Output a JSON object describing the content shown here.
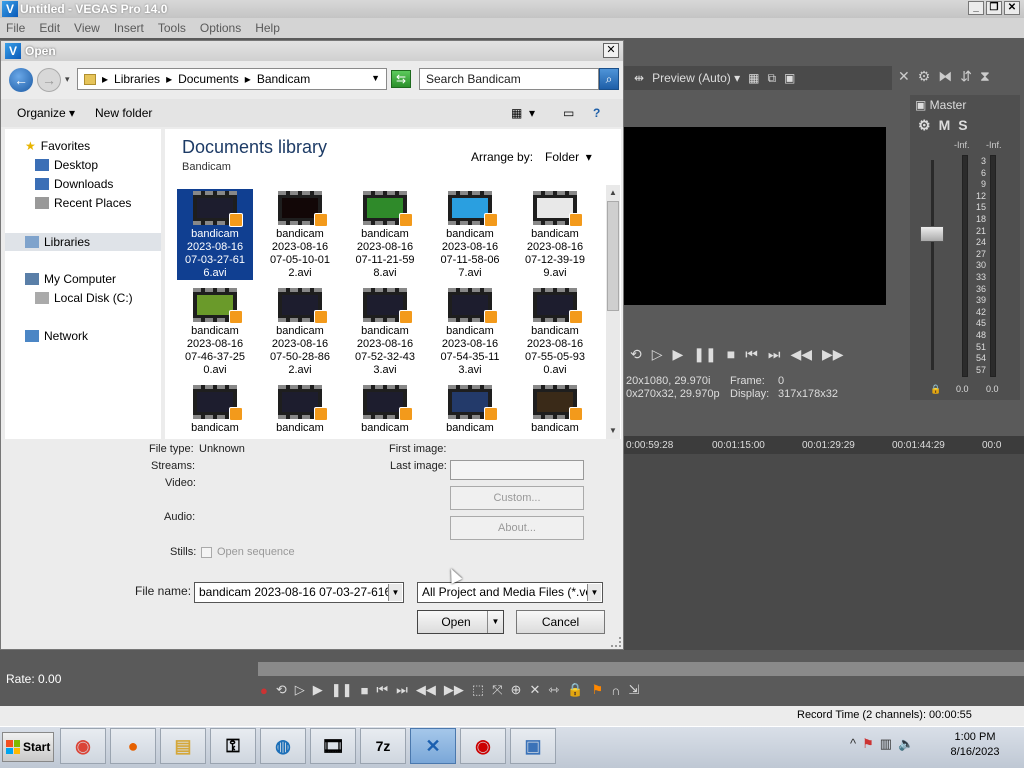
{
  "app": {
    "title": "Untitled - VEGAS Pro 14.0",
    "logo_letter": "V",
    "menu": [
      "File",
      "Edit",
      "View",
      "Insert",
      "Tools",
      "Options",
      "Help"
    ],
    "window_buttons": [
      "_",
      "❐",
      "✕"
    ]
  },
  "preview": {
    "mode_label": "Preview (Auto)",
    "info_left_1": "20x1080, 29.970i",
    "info_left_2": "0x270x32, 29.970p",
    "frame_label": "Frame:",
    "frame_value": "0",
    "display_label": "Display:",
    "display_value": "317x178x32"
  },
  "master": {
    "label": "Master",
    "mute": "M",
    "solo": "S",
    "inf_left": "-Inf.",
    "inf_right": "-Inf.",
    "scale": [
      "3",
      "6",
      "9",
      "12",
      "15",
      "18",
      "21",
      "24",
      "27",
      "30",
      "33",
      "36",
      "39",
      "42",
      "45",
      "48",
      "51",
      "54",
      "57"
    ],
    "bottom_left": "0.0",
    "bottom_right": "0.0"
  },
  "timeline": {
    "ruler": [
      "0:00:59:28",
      "00:01:15:00",
      "00:01:29:29",
      "00:01:44:29",
      "00:0"
    ],
    "rate_label": "Rate: 0.00",
    "record_time": "Record Time (2 channels): 00:00:55"
  },
  "dialog": {
    "title": "Open",
    "close": "✕",
    "breadcrumb": [
      "Libraries",
      "Documents",
      "Bandicam"
    ],
    "search_placeholder": "Search Bandicam",
    "organize": "Organize",
    "new_folder": "New folder",
    "nav": {
      "favorites": "Favorites",
      "desktop": "Desktop",
      "downloads": "Downloads",
      "recent_places": "Recent Places",
      "libraries": "Libraries",
      "my_computer": "My Computer",
      "local_disk": "Local Disk (C:)",
      "network": "Network"
    },
    "library_title": "Documents library",
    "library_sub": "Bandicam",
    "arrange_label": "Arrange by:",
    "arrange_value": "Folder",
    "files": [
      {
        "l1": "bandicam",
        "l2": "2023-08-16",
        "l3": "07-03-27-61",
        "l4": "6.avi"
      },
      {
        "l1": "bandicam",
        "l2": "2023-08-16",
        "l3": "07-05-10-01",
        "l4": "2.avi"
      },
      {
        "l1": "bandicam",
        "l2": "2023-08-16",
        "l3": "07-11-21-59",
        "l4": "8.avi"
      },
      {
        "l1": "bandicam",
        "l2": "2023-08-16",
        "l3": "07-11-58-06",
        "l4": "7.avi"
      },
      {
        "l1": "bandicam",
        "l2": "2023-08-16",
        "l3": "07-12-39-19",
        "l4": "9.avi"
      },
      {
        "l1": "bandicam",
        "l2": "2023-08-16",
        "l3": "07-46-37-25",
        "l4": "0.avi"
      },
      {
        "l1": "bandicam",
        "l2": "2023-08-16",
        "l3": "07-50-28-86",
        "l4": "2.avi"
      },
      {
        "l1": "bandicam",
        "l2": "2023-08-16",
        "l3": "07-52-32-43",
        "l4": "3.avi"
      },
      {
        "l1": "bandicam",
        "l2": "2023-08-16",
        "l3": "07-54-35-11",
        "l4": "3.avi"
      },
      {
        "l1": "bandicam",
        "l2": "2023-08-16",
        "l3": "07-55-05-93",
        "l4": "0.avi"
      },
      {
        "l1": "bandicam",
        "l2": "",
        "l3": "",
        "l4": ""
      },
      {
        "l1": "bandicam",
        "l2": "",
        "l3": "",
        "l4": ""
      },
      {
        "l1": "bandicam",
        "l2": "",
        "l3": "",
        "l4": ""
      },
      {
        "l1": "bandicam",
        "l2": "",
        "l3": "",
        "l4": ""
      },
      {
        "l1": "bandicam",
        "l2": "",
        "l3": "",
        "l4": ""
      }
    ],
    "details": {
      "file_type_label": "File type:",
      "file_type_value": "Unknown",
      "streams_label": "Streams:",
      "video_label": "Video:",
      "audio_label": "Audio:",
      "stills_label": "Stills:",
      "open_sequence": "Open sequence",
      "first_image_label": "First image:",
      "last_image_label": "Last image:",
      "custom_btn": "Custom...",
      "about_btn": "About..."
    },
    "file_name_label": "File name:",
    "file_name_value": "bandicam 2023-08-16 07-03-27-616.",
    "file_type_filter": "All Project and Media Files (*.ve",
    "open_btn": "Open",
    "cancel_btn": "Cancel"
  },
  "taskbar": {
    "start": "Start",
    "clock_time": "1:00 PM",
    "clock_date": "8/16/2023"
  }
}
